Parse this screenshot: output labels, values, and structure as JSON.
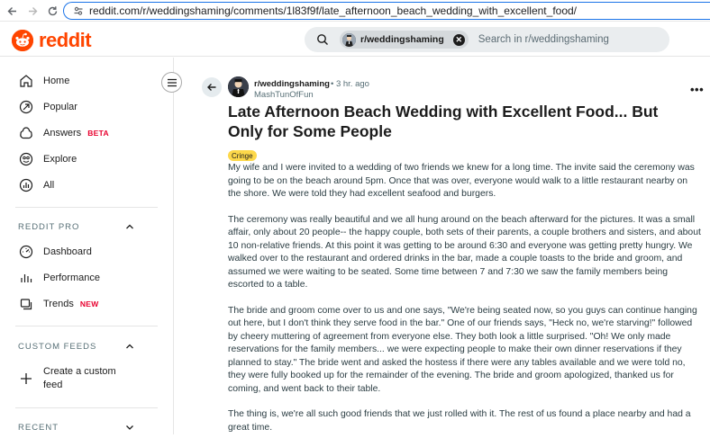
{
  "browser": {
    "back_icon": "arrow-left-icon",
    "forward_icon": "arrow-right-icon",
    "reload_icon": "reload-icon",
    "url": "reddit.com/r/weddingshaming/comments/1l83f9f/late_afternoon_beach_wedding_with_excellent_food/"
  },
  "header": {
    "logo_text": "reddit",
    "brand_color": "#ff4500",
    "search": {
      "chip_label": "r/weddingshaming",
      "placeholder": "Search in r/weddingshaming"
    }
  },
  "sidebar": {
    "main_items": [
      {
        "label": "Home",
        "icon": "home-icon"
      },
      {
        "label": "Popular",
        "icon": "popular-icon"
      },
      {
        "label": "Answers",
        "icon": "answers-icon",
        "badge": "BETA"
      },
      {
        "label": "Explore",
        "icon": "explore-icon"
      },
      {
        "label": "All",
        "icon": "all-icon"
      }
    ],
    "pro_heading": "REDDIT PRO",
    "pro_items": [
      {
        "label": "Dashboard",
        "icon": "dashboard-icon"
      },
      {
        "label": "Performance",
        "icon": "performance-icon"
      },
      {
        "label": "Trends",
        "icon": "trends-icon",
        "badge": "NEW"
      }
    ],
    "custom_feeds_heading": "CUSTOM FEEDS",
    "create_feed_label_line1": "Create a custom",
    "create_feed_label_line2": "feed",
    "recent_heading": "RECENT"
  },
  "post": {
    "subreddit": "r/weddingshaming",
    "time": "• 3 hr. ago",
    "author": "MashTunOfFun",
    "title": "Late Afternoon Beach Wedding with Excellent Food... But Only for Some People",
    "flair": "Cringe",
    "flair_color": "#fdd84a",
    "paragraphs": [
      "My wife and I were invited to a wedding of two friends we knew for a long time. The invite said the ceremony was going to be on the beach around 5pm. Once that was over, everyone would walk to a little restaurant nearby on the shore. We were told they had excellent seafood and burgers.",
      "The ceremony was really beautiful and we all hung around on the beach afterward for the pictures. It was a small affair, only about 20 people-- the happy couple, both sets of their parents, a couple brothers and sisters, and about 10 non-relative friends. At this point it was getting to be around 6:30 and everyone was getting pretty hungry. We walked over to the restaurant and ordered drinks in the bar, made a couple toasts to the bride and groom, and assumed we were waiting to be seated. Some time between 7 and 7:30 we saw the family members being escorted to a table.",
      "The bride and groom come over to us and one says, \"We're being seated now, so you guys can continue hanging out here, but I don't think they serve food in the bar.\" One of our friends says, \"Heck no, we're starving!\" followed by cheery muttering of agreement from everyone else. They both look a little surprised. \"Oh! We only made reservations for the family members... we were expecting people to make their own dinner reservations if they planned to stay.\" The bride went and asked the hostess if there were any tables available and we were told no, they were fully booked up for the remainder of the evening. The bride and groom apologized, thanked us for coming, and went back to their table.",
      "The thing is, we're all such good friends that we just rolled with it. The rest of us found a place nearby and had a great time."
    ]
  }
}
